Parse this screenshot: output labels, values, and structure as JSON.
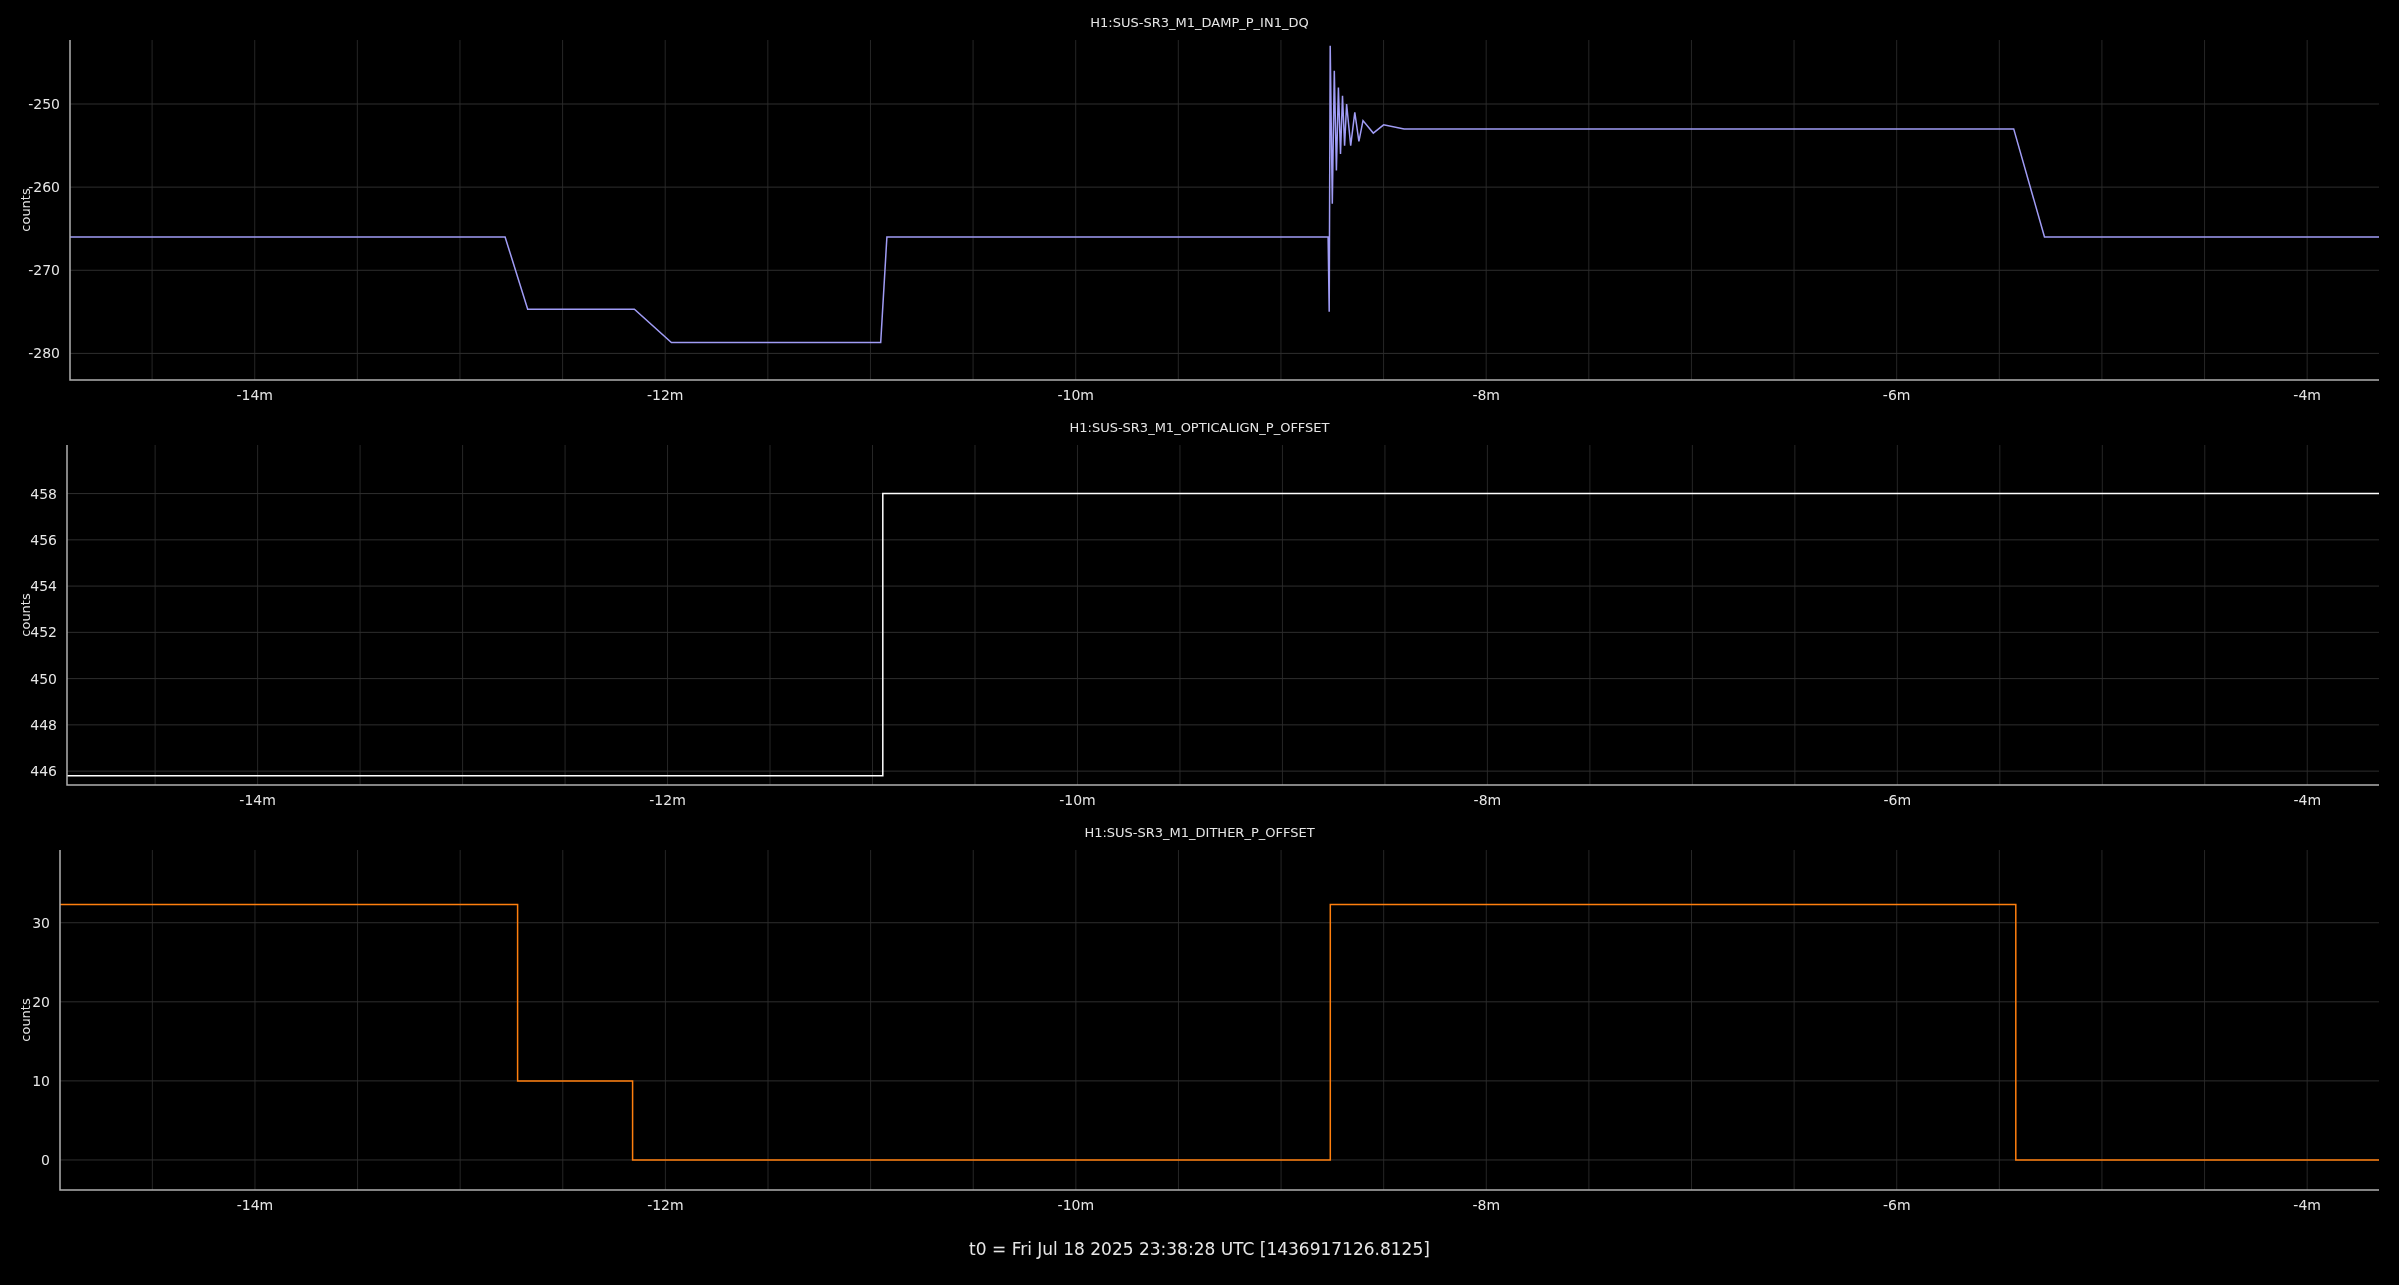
{
  "charts": [
    {
      "chart_data": {
        "type": "line",
        "grid": true,
        "title": "H1:SUS-SR3_M1_DAMP_P_IN1_DQ",
        "ylabel": "counts",
        "x": [
          -14.9,
          -12.78,
          -12.67,
          -12.15,
          -11.97,
          -10.95,
          -10.92,
          -8.77,
          -8.765,
          -8.76,
          -8.75,
          -8.74,
          -8.73,
          -8.72,
          -8.71,
          -8.7,
          -8.69,
          -8.68,
          -8.66,
          -8.64,
          -8.62,
          -8.6,
          -8.55,
          -8.5,
          -8.4,
          -5.43,
          -5.28,
          -3.65
        ],
        "series": [
          {
            "color": "#a09cf5",
            "values": [
              -266,
              -266,
              -274.7,
              -274.7,
              -278.7,
              -278.7,
              -266,
              -266,
              -275,
              -243,
              -262,
              -246,
              -258,
              -248,
              -256,
              -249,
              -255,
              -250,
              -255,
              -251,
              -254.5,
              -252,
              -253.5,
              -252.5,
              -253,
              -253,
              -266,
              -266
            ]
          }
        ],
        "xlim": [
          -14.9,
          -3.65
        ],
        "ylim": [
          -283.2,
          -242.3
        ],
        "xticks": [
          {
            "value": -14,
            "label": "-14m"
          },
          {
            "value": -12,
            "label": "-12m"
          },
          {
            "value": -10,
            "label": "-10m"
          },
          {
            "value": -8,
            "label": "-8m"
          },
          {
            "value": -6,
            "label": "-6m"
          },
          {
            "value": -4,
            "label": "-4m"
          }
        ],
        "yticks": [
          {
            "value": -250,
            "label": "-250"
          },
          {
            "value": -260,
            "label": "-260"
          },
          {
            "value": -270,
            "label": "-270"
          },
          {
            "value": -280,
            "label": "-280"
          }
        ]
      }
    },
    {
      "chart_data": {
        "type": "line",
        "grid": true,
        "title": "H1:SUS-SR3_M1_OPTICALIGN_P_OFFSET",
        "ylabel": "counts",
        "x": [
          -14.93,
          -10.95,
          -10.95,
          -3.65
        ],
        "series": [
          {
            "color": "#ffffff",
            "values": [
              445.8,
              445.8,
              458,
              458
            ]
          }
        ],
        "xlim": [
          -14.93,
          -3.65
        ],
        "ylim": [
          445.4,
          460.1
        ],
        "xticks": [
          {
            "value": -14,
            "label": "-14m"
          },
          {
            "value": -12,
            "label": "-12m"
          },
          {
            "value": -10,
            "label": "-10m"
          },
          {
            "value": -8,
            "label": "-8m"
          },
          {
            "value": -6,
            "label": "-6m"
          },
          {
            "value": -4,
            "label": "-4m"
          }
        ],
        "yticks": [
          {
            "value": 458,
            "label": "458"
          },
          {
            "value": 456,
            "label": "456"
          },
          {
            "value": 454,
            "label": "454"
          },
          {
            "value": 452,
            "label": "452"
          },
          {
            "value": 450,
            "label": "450"
          },
          {
            "value": 448,
            "label": "448"
          },
          {
            "value": 446,
            "label": "446"
          }
        ]
      }
    },
    {
      "chart_data": {
        "type": "line",
        "grid": true,
        "title": "H1:SUS-SR3_M1_DITHER_P_OFFSET",
        "ylabel": "counts",
        "x": [
          -14.95,
          -12.72,
          -12.72,
          -12.16,
          -12.16,
          -8.76,
          -8.76,
          -5.42,
          -5.42,
          -3.65
        ],
        "series": [
          {
            "color": "#ff7f0e",
            "values": [
              32.3,
              32.3,
              10,
              10,
              0,
              0,
              32.3,
              32.3,
              0,
              0
            ]
          }
        ],
        "xlim": [
          -14.95,
          -3.65
        ],
        "ylim": [
          -3.8,
          39.2
        ],
        "xticks": [
          {
            "value": -14,
            "label": "-14m"
          },
          {
            "value": -12,
            "label": "-12m"
          },
          {
            "value": -10,
            "label": "-10m"
          },
          {
            "value": -8,
            "label": "-8m"
          },
          {
            "value": -6,
            "label": "-6m"
          },
          {
            "value": -4,
            "label": "-4m"
          }
        ],
        "yticks": [
          {
            "value": 30,
            "label": "30"
          },
          {
            "value": 20,
            "label": "20"
          },
          {
            "value": 10,
            "label": "10"
          },
          {
            "value": 0,
            "label": "0"
          }
        ]
      }
    }
  ],
  "footer": "t0 = Fri Jul 18 2025 23:38:28 UTC [1436917126.8125]"
}
